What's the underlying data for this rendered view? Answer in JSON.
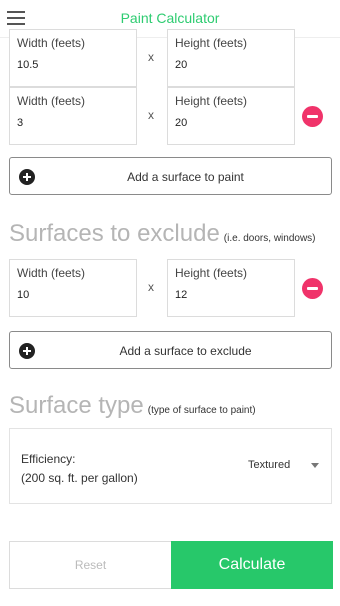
{
  "header": {
    "title": "Paint Calculator",
    "menu_icon": "hamburger-menu-icon"
  },
  "surfaces_to_paint": [
    {
      "width_label": "Width (feets)",
      "width_value": "10.5",
      "height_label": "Height (feets)",
      "height_value": "20",
      "times": "x"
    },
    {
      "width_label": "Width (feets)",
      "width_value": "3",
      "height_label": "Height (feets)",
      "height_value": "20",
      "times": "x"
    }
  ],
  "add_paint_label": "Add a surface to paint",
  "exclude": {
    "title": "Surfaces to exclude",
    "note": "(i.e. doors, windows)",
    "items": [
      {
        "width_label": "Width (feets)",
        "width_value": "10",
        "height_label": "Height (feets)",
        "height_value": "12",
        "times": "x"
      }
    ],
    "add_label": "Add a surface to exclude"
  },
  "surface_type": {
    "title": "Surface type",
    "note": "(type of surface to paint)",
    "efficiency_line1": "Efficiency:",
    "efficiency_line2": "(200 sq. ft. per gallon)",
    "selected": "Textured"
  },
  "actions": {
    "reset": "Reset",
    "calculate": "Calculate"
  },
  "colors": {
    "accent": "#27c86a",
    "title": "#2ecc71",
    "remove": "#f0336a"
  }
}
